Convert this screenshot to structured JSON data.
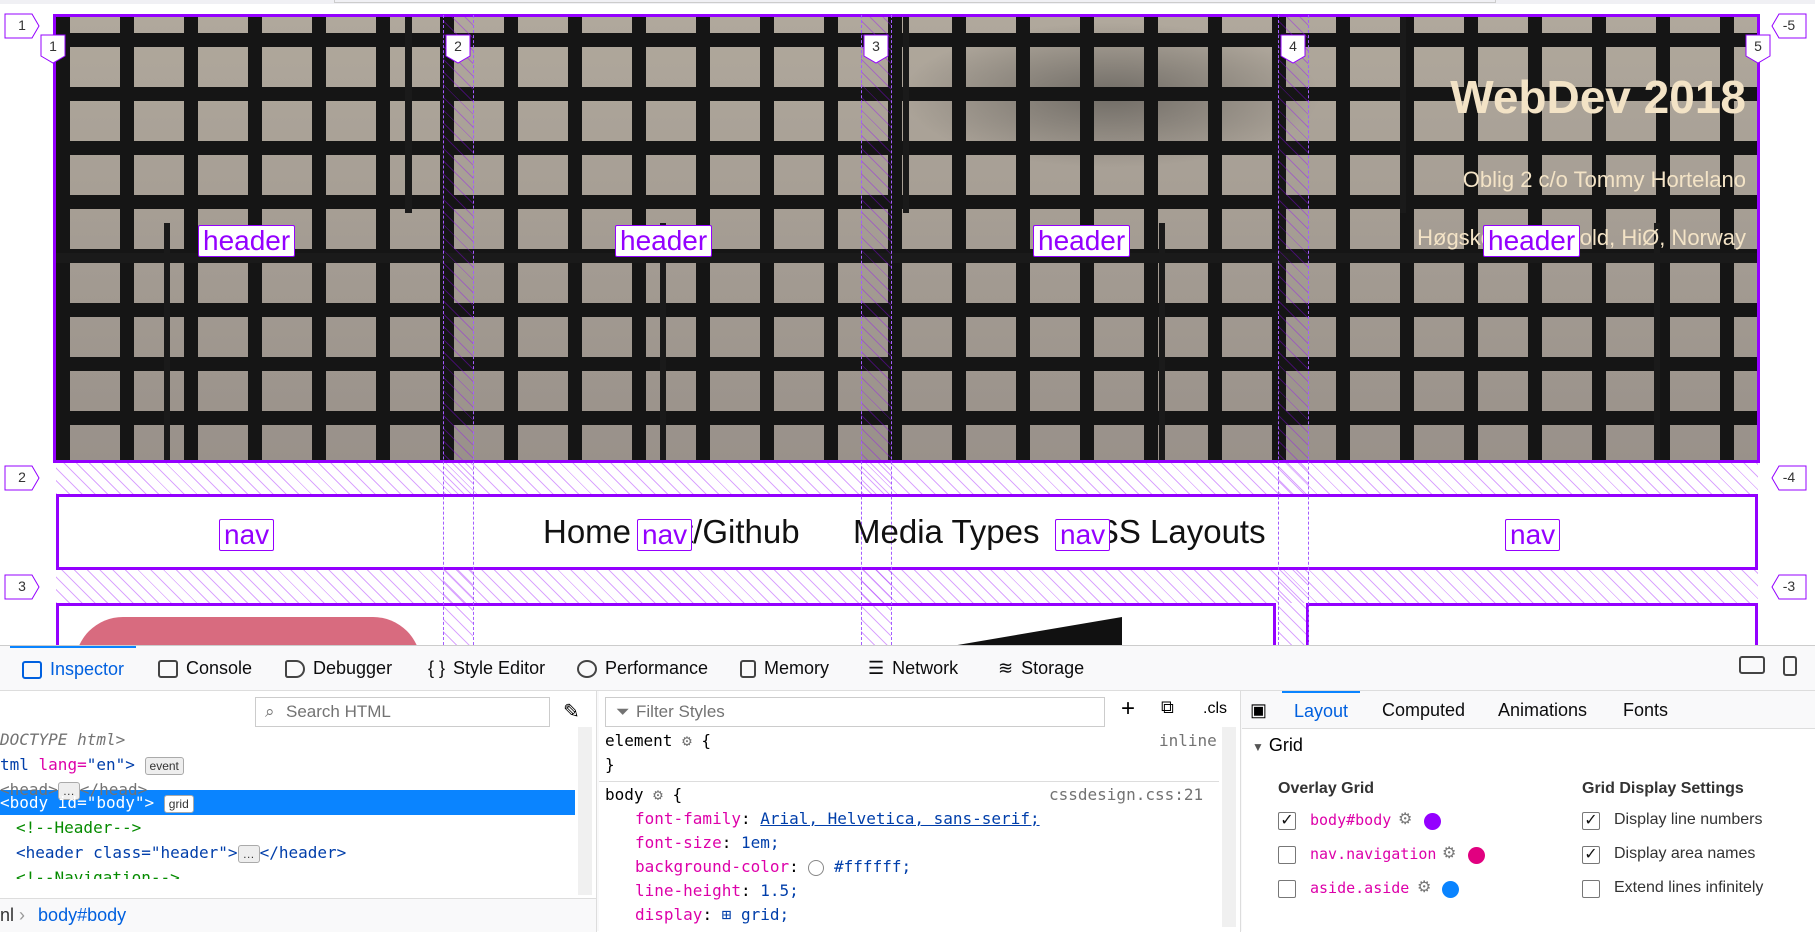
{
  "page": {
    "header_title": "WebDev 2018",
    "header_subtitle": "Oblig 2 c/o Tommy Hortelano",
    "header_school": "Høgskolen i Østfold, HiØ, Norway",
    "nav_links": [
      "Home",
      "Git/Github",
      "Media Types",
      "CSS Layouts"
    ]
  },
  "grid_overlay": {
    "column_lines_top": [
      "1",
      "2",
      "3",
      "4",
      "5"
    ],
    "column_line_left_outer": "1",
    "column_line_right_outer": "-5",
    "row_lines_left": [
      "2",
      "3"
    ],
    "row_lines_right": [
      "-4",
      "-3"
    ],
    "area_header": "header",
    "area_nav": "nav",
    "color": "#9400ff"
  },
  "devtools": {
    "tabs": [
      "Inspector",
      "Console",
      "Debugger",
      "Style Editor",
      "Performance",
      "Memory",
      "Network",
      "Storage"
    ],
    "active_tab": "Inspector",
    "markup": {
      "search_placeholder": "Search HTML",
      "lines": [
        {
          "a": "DOCTYPE html>"
        },
        {
          "a": "tml",
          "b": " lang=",
          "c": "\"en\"",
          "d": ">",
          "badge": "event"
        },
        {
          "a": "<head>",
          "badge": "…",
          "d": "</head>"
        },
        {
          "a": "<body id=\"body\">",
          "badge": "grid"
        },
        {
          "a": "<!--Header-->"
        },
        {
          "a": "<header class=\"header\">",
          "badge": "…",
          "d": "</header>"
        },
        {
          "a": "<!--Navigation-->"
        }
      ],
      "breadcrumb": [
        "nl",
        "body#body"
      ]
    },
    "rules": {
      "filter_placeholder": "Filter Styles",
      "cls_label": ".cls",
      "element_selector": "element",
      "element_source": "inline",
      "body_selector": "body",
      "body_source": "cssdesign.css:21",
      "declarations": [
        {
          "prop": "font-family",
          "val": "Arial, Helvetica, sans-serif;"
        },
        {
          "prop": "font-size",
          "val": "1em;"
        },
        {
          "prop": "background-color",
          "val": "#ffffff;"
        },
        {
          "prop": "line-height",
          "val": "1.5;"
        },
        {
          "prop": "display",
          "val": "grid;"
        }
      ]
    },
    "sidebar": {
      "tabs": [
        "Layout",
        "Computed",
        "Animations",
        "Fonts"
      ],
      "active_tab": "Layout",
      "section": "Grid",
      "overlay_title": "Overlay Grid",
      "overlays": [
        {
          "name": "body#body",
          "checked": true,
          "color": "#9400ff"
        },
        {
          "name": "nav.navigation",
          "checked": false,
          "color": "#e10080"
        },
        {
          "name": "aside.aside",
          "checked": false,
          "color": "#0a84ff"
        }
      ],
      "settings_title": "Grid Display Settings",
      "settings": [
        {
          "name": "Display line numbers",
          "checked": true
        },
        {
          "name": "Display area names",
          "checked": true
        },
        {
          "name": "Extend lines infinitely",
          "checked": false
        }
      ]
    }
  }
}
